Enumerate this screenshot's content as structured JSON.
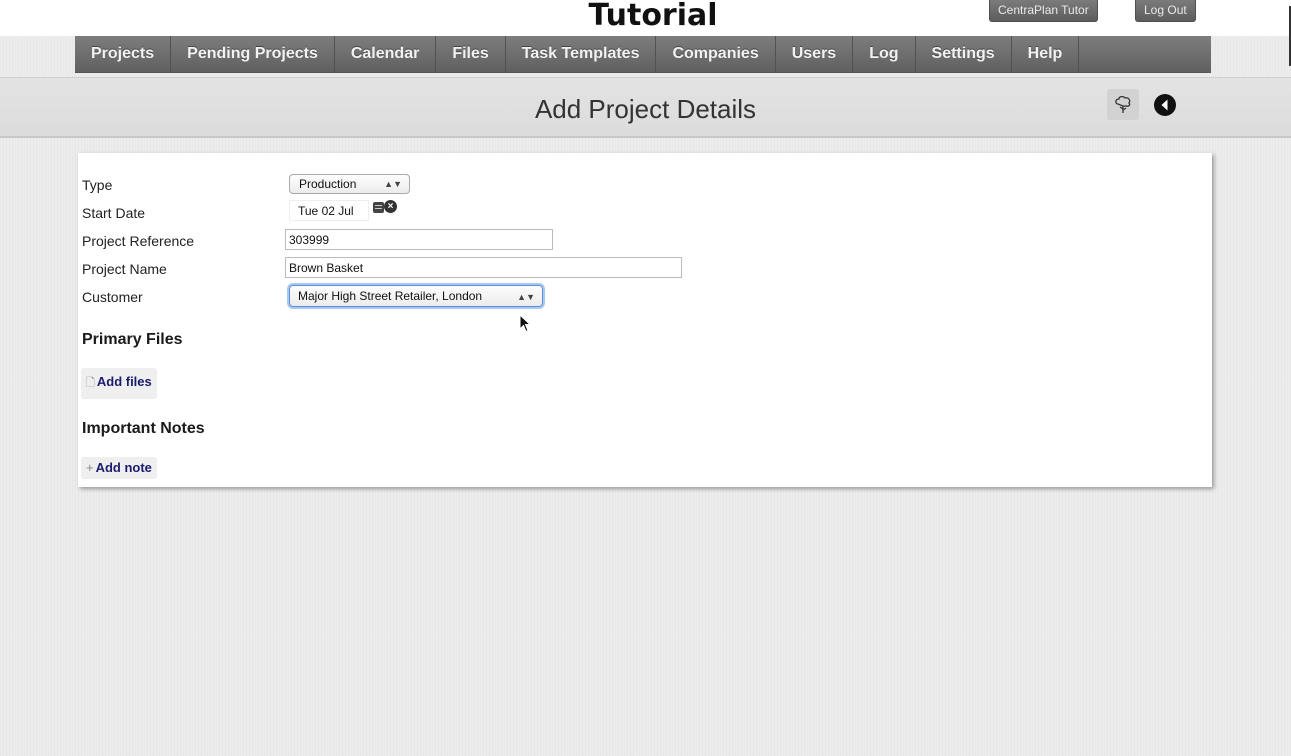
{
  "app": {
    "title": "Tutorial",
    "tutor_label": "CentraPlan Tutor",
    "logout_label": "Log Out"
  },
  "nav": {
    "items": [
      {
        "label": "Projects"
      },
      {
        "label": "Pending Projects"
      },
      {
        "label": "Calendar"
      },
      {
        "label": "Files"
      },
      {
        "label": "Task Templates"
      },
      {
        "label": "Companies"
      },
      {
        "label": "Users"
      },
      {
        "label": "Log"
      },
      {
        "label": "Settings"
      },
      {
        "label": "Help"
      }
    ]
  },
  "header": {
    "title": "Add Project Details",
    "icons": [
      "tree-icon",
      "back-arrow-icon"
    ]
  },
  "form": {
    "type_label": "Type",
    "type_value": "Production",
    "start_date_label": "Start Date",
    "start_date_value": "Tue 02 Jul",
    "reference_label": "Project Reference",
    "reference_value": "303999",
    "name_label": "Project Name",
    "name_value": "Brown Basket",
    "customer_label": "Customer",
    "customer_value": "Major High Street Retailer, London"
  },
  "primary_files": {
    "heading": "Primary Files",
    "add_label": "Add files"
  },
  "notes": {
    "heading": "Important Notes",
    "add_label": "Add note"
  },
  "colors": {
    "nav_bg": "#6b6b6b",
    "link_blue": "#1c1c6e",
    "focus_blue": "#6aa0e8"
  }
}
